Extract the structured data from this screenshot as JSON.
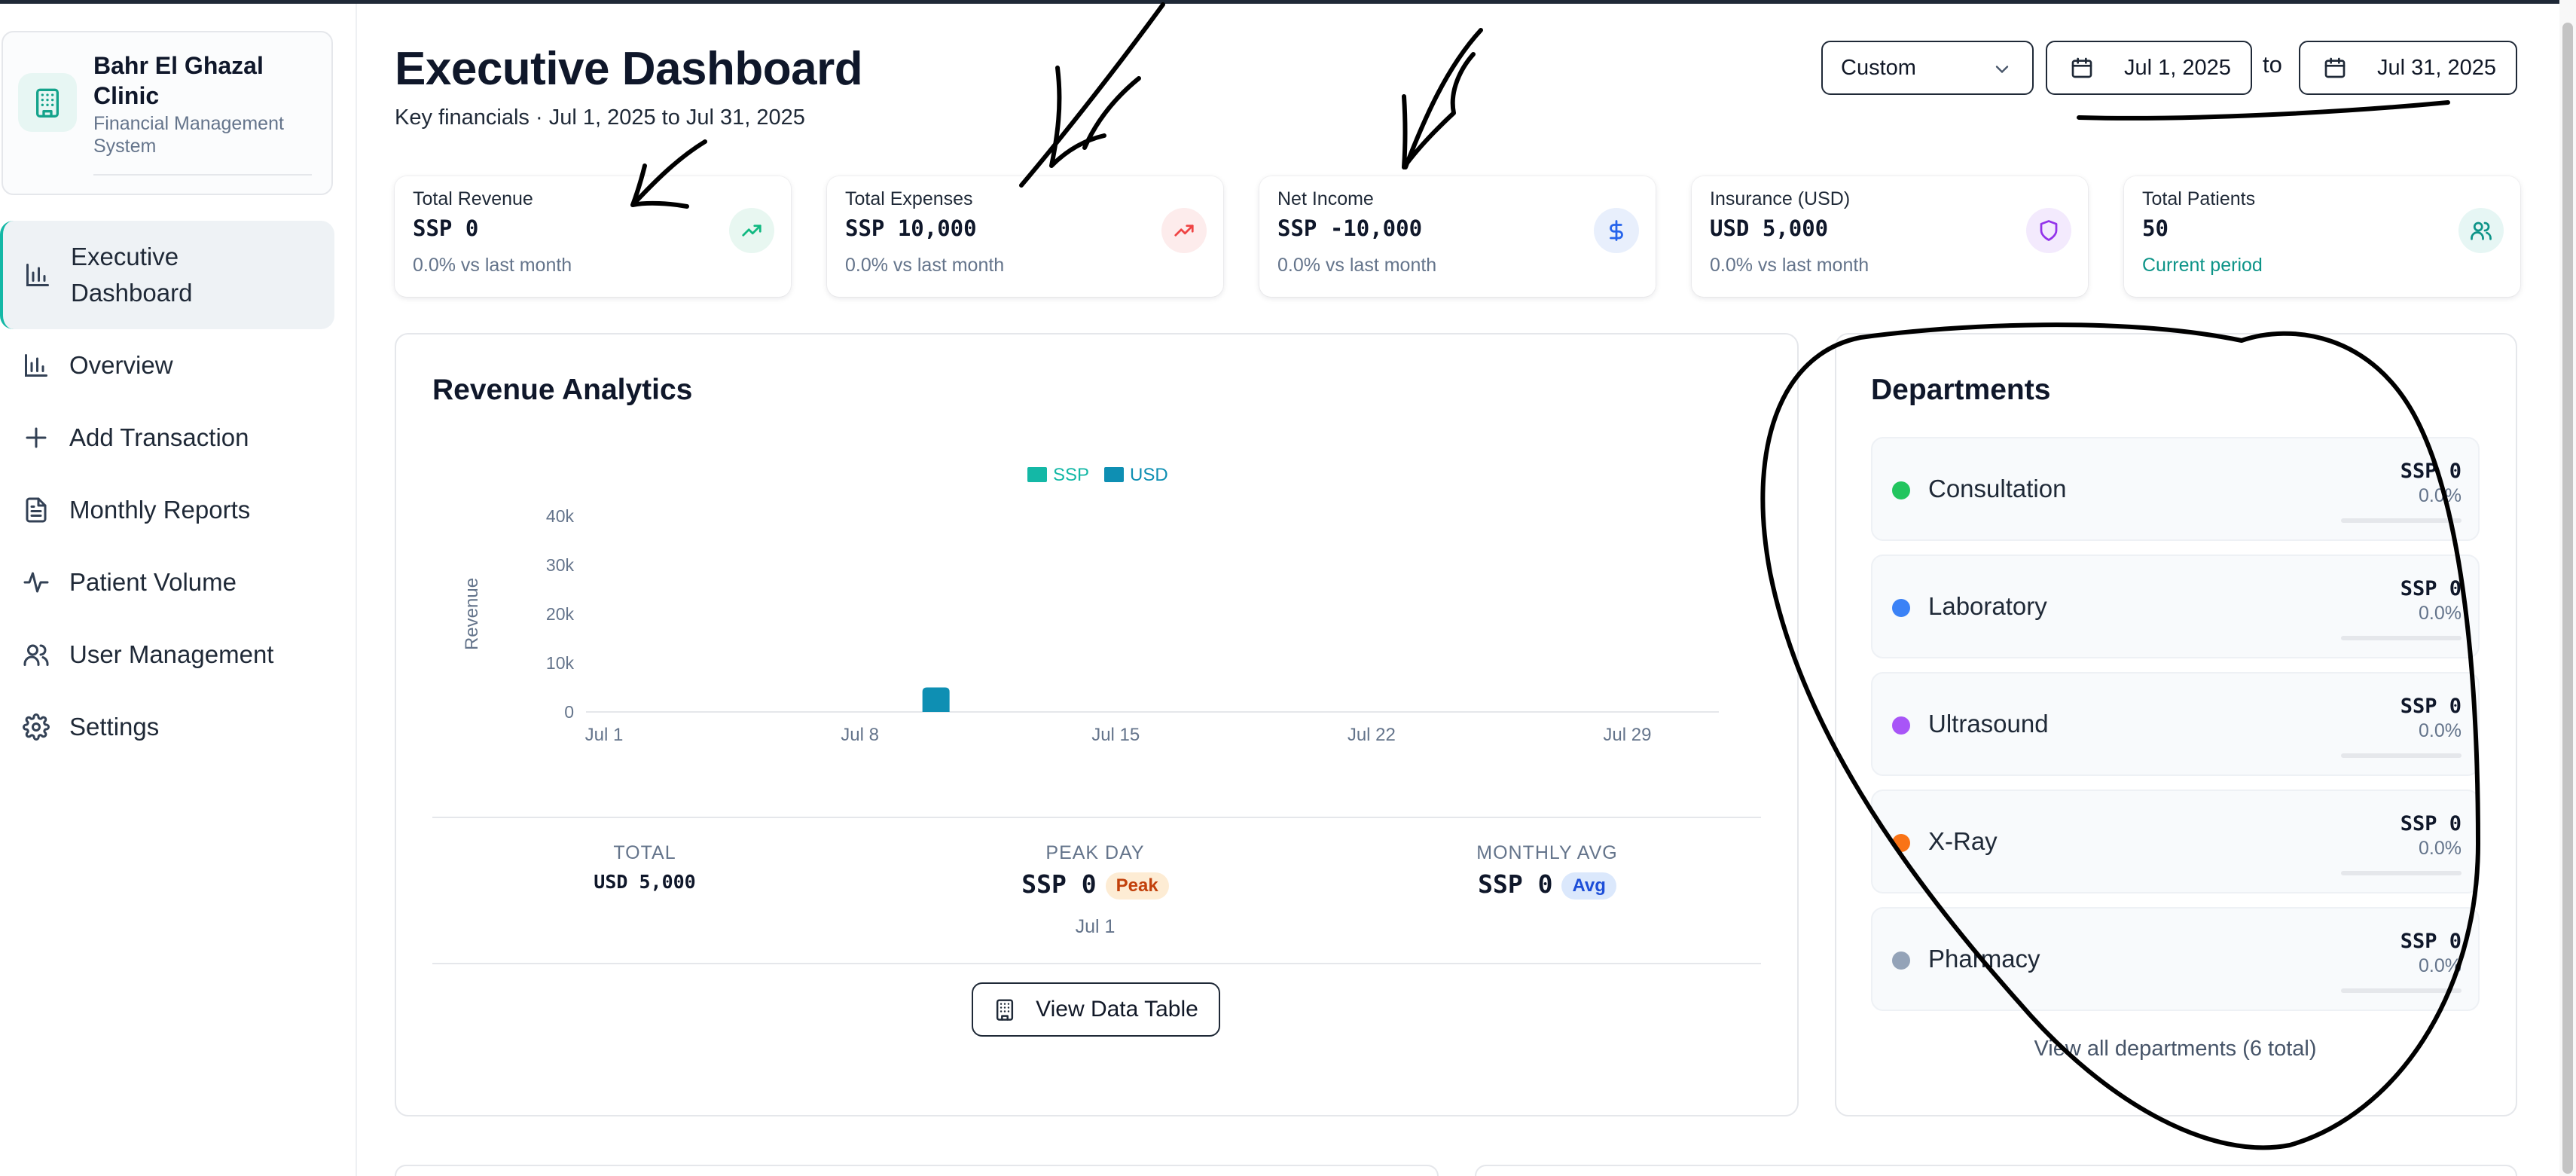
{
  "sidebar": {
    "brand_name": "Bahr El Ghazal Clinic",
    "brand_subtitle": "Financial Management System",
    "items": [
      {
        "label": "Executive Dashboard",
        "icon": "bar-chart-icon",
        "active": true
      },
      {
        "label": "Overview",
        "icon": "bar-chart-icon"
      },
      {
        "label": "Add Transaction",
        "icon": "plus-icon"
      },
      {
        "label": "Monthly Reports",
        "icon": "document-icon"
      },
      {
        "label": "Patient Volume",
        "icon": "activity-icon"
      },
      {
        "label": "User Management",
        "icon": "users-icon"
      },
      {
        "label": "Settings",
        "icon": "gear-icon"
      }
    ]
  },
  "header": {
    "title": "Executive Dashboard",
    "subtitle": "Key financials · Jul 1, 2025 to Jul 31, 2025",
    "range_select": "Custom",
    "start_date": "Jul 1, 2025",
    "to_label": "to",
    "end_date": "Jul 31, 2025"
  },
  "kpis": [
    {
      "label": "Total Revenue",
      "value": "SSP 0",
      "note": "0.0% vs last month",
      "icon": "trending-up-icon",
      "color": "#10b981",
      "bg": "#e8f7f1"
    },
    {
      "label": "Total Expenses",
      "value": "SSP 10,000",
      "note": "0.0% vs last month",
      "icon": "trending-up-icon",
      "color": "#ef4444",
      "bg": "#fdecec"
    },
    {
      "label": "Net Income",
      "value": "SSP -10,000",
      "note": "0.0% vs last month",
      "icon": "dollar-icon",
      "color": "#2563eb",
      "bg": "#e8effc"
    },
    {
      "label": "Insurance (USD)",
      "value": "USD 5,000",
      "note": "0.0% vs last month",
      "icon": "shield-icon",
      "color": "#9333ea",
      "bg": "#f3eafd"
    },
    {
      "label": "Total Patients",
      "value": "50",
      "note": "Current period",
      "icon": "users-icon",
      "color": "#0d9488",
      "bg": "#e6f6f4"
    }
  ],
  "revenue": {
    "title": "Revenue Analytics",
    "total_label": "TOTAL",
    "total_value": "USD 5,000",
    "peak_label": "PEAK DAY",
    "peak_value": "SSP 0",
    "peak_badge": "Peak",
    "peak_date": "Jul 1",
    "avg_label": "MONTHLY AVG",
    "avg_value": "SSP 0",
    "avg_badge": "Avg",
    "view_table": "View Data Table"
  },
  "chart_data": {
    "type": "bar",
    "ylabel": "Revenue",
    "xlabel": "",
    "ylim": [
      0,
      40000
    ],
    "yticks": [
      "0",
      "10k",
      "20k",
      "30k",
      "40k"
    ],
    "xticks": [
      "Jul 1",
      "Jul 8",
      "Jul 15",
      "Jul 22",
      "Jul 29"
    ],
    "legend_position": "top-center",
    "series": [
      {
        "name": "SSP",
        "color": "#14b8a6",
        "points": []
      },
      {
        "name": "USD",
        "color": "#0e8fb3",
        "points": [
          {
            "day": 10,
            "value": 5000
          }
        ]
      }
    ]
  },
  "departments": {
    "title": "Departments",
    "items": [
      {
        "name": "Consultation",
        "value": "SSP 0",
        "pct": "0.0%",
        "color": "#22c55e"
      },
      {
        "name": "Laboratory",
        "value": "SSP 0",
        "pct": "0.0%",
        "color": "#3b82f6"
      },
      {
        "name": "Ultrasound",
        "value": "SSP 0",
        "pct": "0.0%",
        "color": "#a855f7"
      },
      {
        "name": "X-Ray",
        "value": "SSP 0",
        "pct": "0.0%",
        "color": "#f97316"
      },
      {
        "name": "Pharmacy",
        "value": "SSP 0",
        "pct": "0.0%",
        "color": "#94a3b8"
      }
    ],
    "view_all": "View all departments (6 total)"
  }
}
